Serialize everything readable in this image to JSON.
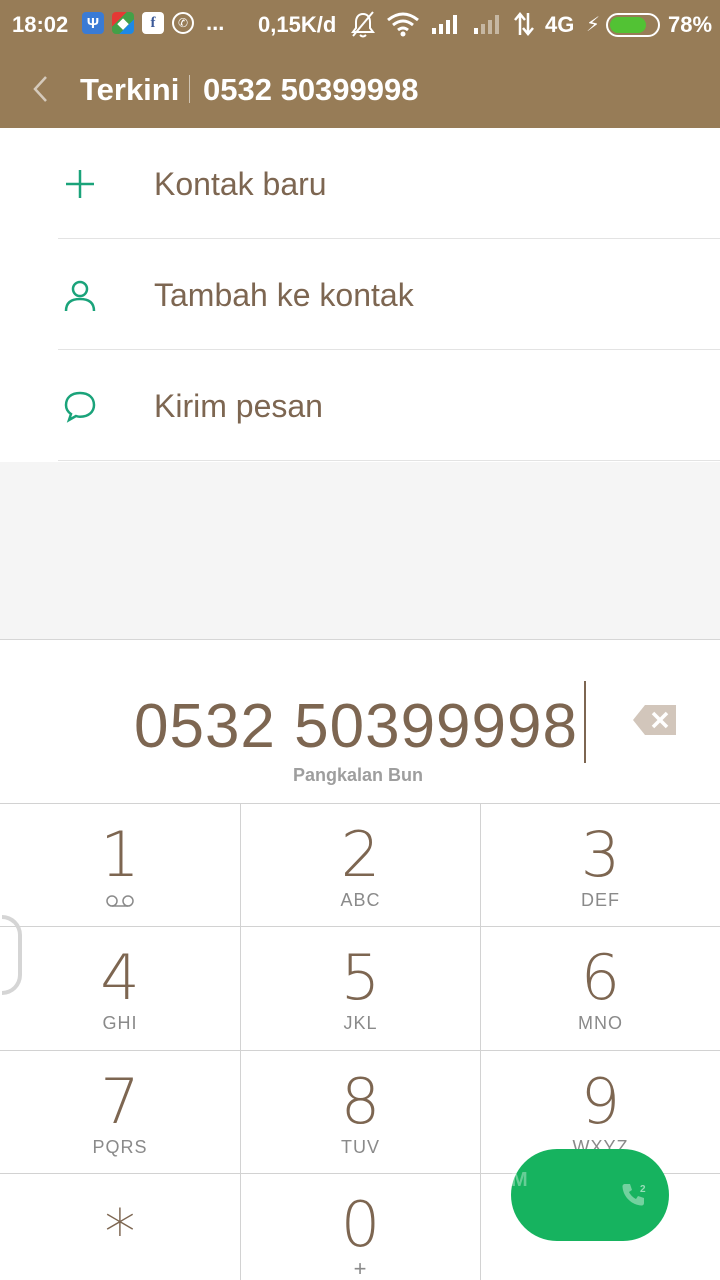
{
  "status_bar": {
    "time": "18:02",
    "notification_icons": [
      "trident-app-icon",
      "map-app-icon",
      "facebook-icon",
      "whatsapp-icon"
    ],
    "more_indicator": "...",
    "speed": "0,15K/d",
    "network": "4G",
    "battery_percent": "78%",
    "battery_level": 0.78
  },
  "title_bar": {
    "section": "Terkini",
    "number": "0532 50399998"
  },
  "options": [
    {
      "label": "Kontak baru",
      "icon": "plus-icon"
    },
    {
      "label": "Tambah ke kontak",
      "icon": "person-icon"
    },
    {
      "label": "Kirim pesan",
      "icon": "message-bubble-icon"
    }
  ],
  "dialer": {
    "number": "0532 50399998",
    "location": "Pangkalan Bun"
  },
  "keys": [
    {
      "digit": "1",
      "letters": ""
    },
    {
      "digit": "2",
      "letters": "ABC"
    },
    {
      "digit": "3",
      "letters": "DEF"
    },
    {
      "digit": "4",
      "letters": "GHI"
    },
    {
      "digit": "5",
      "letters": "JKL"
    },
    {
      "digit": "6",
      "letters": "MNO"
    },
    {
      "digit": "7",
      "letters": "PQRS"
    },
    {
      "digit": "8",
      "letters": "TUV"
    },
    {
      "digit": "9",
      "letters": "WXYZ"
    },
    {
      "digit": "*",
      "letters": ""
    },
    {
      "digit": "0",
      "letters": "+"
    },
    {
      "digit": "",
      "letters": ""
    }
  ],
  "call_button": {
    "sim_label": "M",
    "sim_number": "2"
  },
  "colors": {
    "header": "#977c57",
    "text_brown": "#7d6651",
    "accent_green": "#16b35f",
    "icon_teal": "#1aa37a"
  }
}
